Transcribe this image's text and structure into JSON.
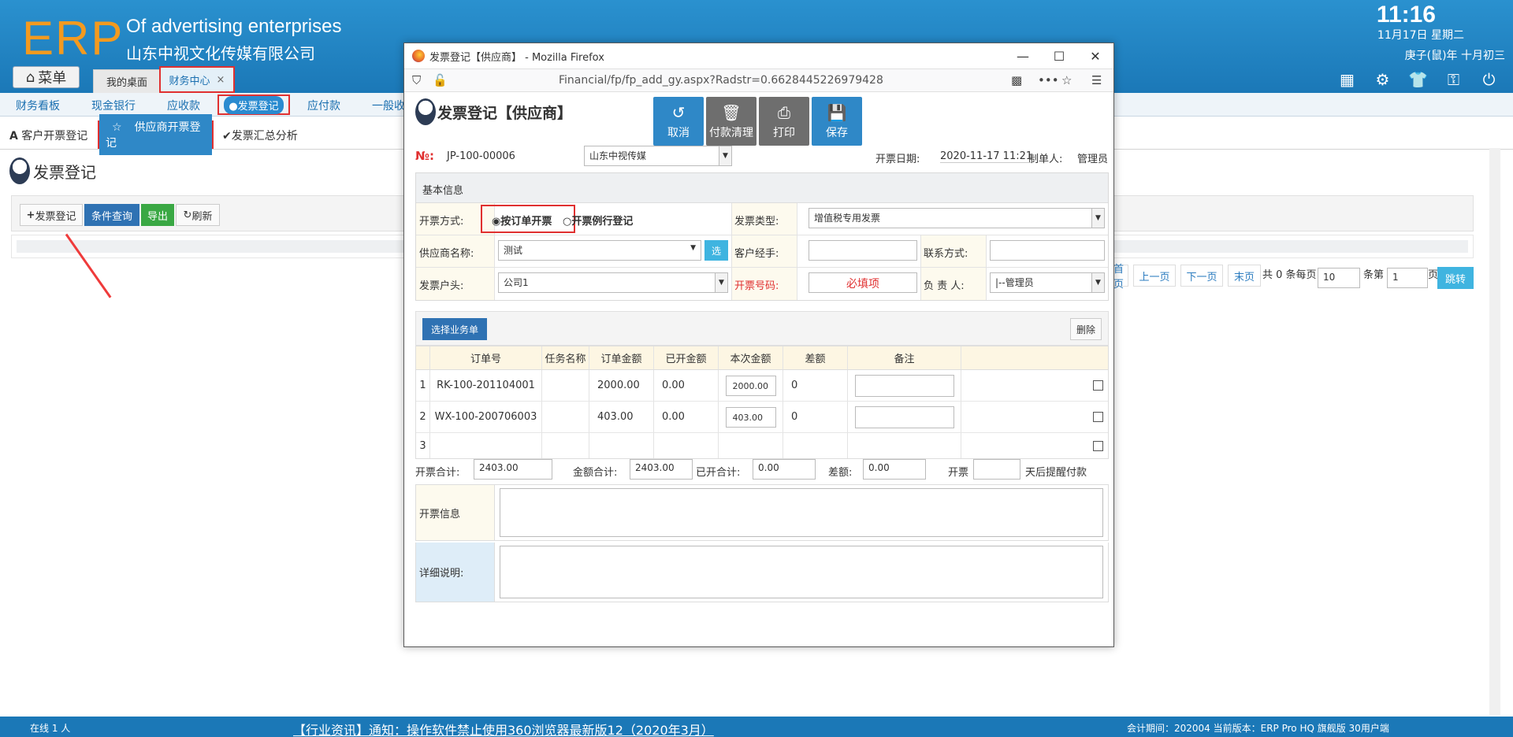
{
  "header": {
    "logo": "ERP",
    "slogan": "Of advertising enterprises",
    "company": "山东中视文化传媒有限公司",
    "time": "11:16",
    "date": "11月17日 星期二",
    "lunar": "庚子(鼠)年 十月初三",
    "menu": "菜单",
    "tabs": [
      "我的桌面",
      "财务中心"
    ],
    "close_glyph": "×"
  },
  "nav": {
    "items": [
      "财务看板",
      "现金银行",
      "应收款",
      "应付款",
      "一般收"
    ],
    "active": "●发票登记"
  },
  "subtabs": {
    "customer": "客户开票登记",
    "supplier": "供应商开票登记",
    "summary": "发票汇总分析"
  },
  "page": {
    "title": "发票登记"
  },
  "toolbar": {
    "add": "发票登记",
    "query": "条件查询",
    "export": "导出",
    "refresh": "刷新"
  },
  "pager": {
    "first": "首页",
    "prev": "上一页",
    "next": "下一页",
    "last": "末页",
    "total_text": "共 0 条每页",
    "per_page": "10",
    "page_text": "条第",
    "page_num": "1",
    "page_suffix": "页",
    "jump": "跳转"
  },
  "footer": {
    "online": "在线  1  人",
    "news": "【行业资讯】通知：操作软件禁止使用360浏览器最新版12（2020年3月）",
    "version": "会计期间：202004 当前版本：ERP Pro HQ 旗舰版 30用户端"
  },
  "popup": {
    "window_title": "发票登记【供应商】 - Mozilla Firefox",
    "url": "Financial/fp/fp_add_gy.aspx?Radstr=0.6628445226979428",
    "title": "发票登记【供应商】",
    "buttons": {
      "cancel": "取消",
      "clear": "付款清理",
      "print": "打印",
      "save": "保存"
    },
    "no_label": "№:",
    "no_value": "JP-100-00006",
    "company_select": "山东中视传媒",
    "date_label": "开票日期:",
    "date_value": "2020-11-17 11:21",
    "maker_label": "制单人:",
    "maker_value": "管理员",
    "section": "基本信息",
    "form": {
      "mode_label": "开票方式:",
      "mode_opt1": "按订单开票",
      "mode_opt2": "开票例行登记",
      "type_label": "发票类型:",
      "type_value": "增值税专用发票",
      "supplier_label": "供应商名称:",
      "supplier_value": "测试",
      "pick": "选",
      "manager_label": "客户经手:",
      "contact_label": "联系方式:",
      "head_label": "发票户头:",
      "head_value": "公司1",
      "number_label": "开票号码:",
      "number_hint": "必填项",
      "owner_label": "负 责 人:",
      "owner_value": "|--管理员"
    },
    "select_orders": "选择业务单",
    "delete": "删除",
    "grid": {
      "headers": [
        "订单号",
        "任务名称",
        "订单金额",
        "已开金额",
        "本次金额",
        "差额",
        "备注"
      ],
      "rows": [
        {
          "n": "1",
          "order": "RK-100-201104001",
          "task": "",
          "amount": "2000.00",
          "opened": "0.00",
          "current": "2000.00",
          "diff": "0"
        },
        {
          "n": "2",
          "order": "WX-100-200706003",
          "task": "",
          "amount": "403.00",
          "opened": "0.00",
          "current": "403.00",
          "diff": "0"
        },
        {
          "n": "3",
          "order": "",
          "task": "",
          "amount": "",
          "opened": "",
          "current": "",
          "diff": ""
        }
      ]
    },
    "sums": {
      "invoice_label": "开票合计:",
      "invoice": "2403.00",
      "amount_label": "金额合计:",
      "amount": "2403.00",
      "opened_label": "已开合计:",
      "opened": "0.00",
      "diff_label": "差额:",
      "diff": "0.00",
      "remind_pre": "开票",
      "remind_post": "天后提醒付款"
    },
    "info_label": "开票信息",
    "detail_label": "详细说明:"
  },
  "colors": {
    "brand": "#1b78b7",
    "logo": "#f39a1f",
    "required": "#e03030",
    "button": "#2f88c7",
    "export": "#3aa844"
  }
}
